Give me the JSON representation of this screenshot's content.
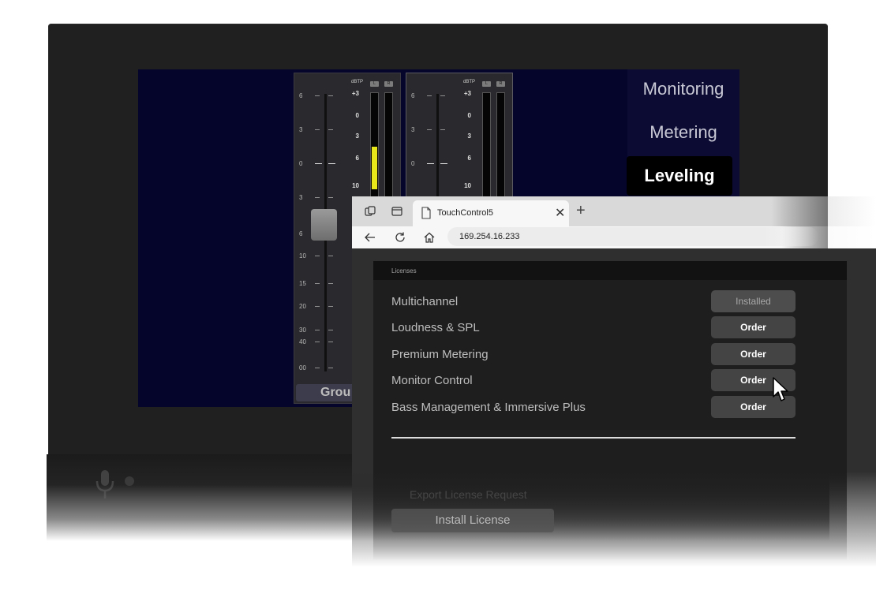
{
  "device": {
    "screen": {
      "strips": [
        {
          "fader_scale": [
            "6",
            "3",
            "0",
            "3",
            "6",
            "10",
            "15",
            "20",
            "30",
            "40",
            "00"
          ],
          "meter_header": "dBTP",
          "channels": [
            "L",
            "R"
          ],
          "meter_scale": [
            "+3",
            "0",
            "3",
            "6",
            "10"
          ],
          "meter_level_fraction": 0.15
        },
        {
          "fader_scale": [
            "6",
            "3",
            "0"
          ],
          "meter_header": "dBTP",
          "channels": [
            "L",
            "R"
          ],
          "meter_scale": [
            "+3",
            "0",
            "3",
            "6",
            "10"
          ]
        }
      ],
      "group_label": "Grou",
      "side_nav": [
        "Monitoring",
        "Metering",
        "Leveling"
      ],
      "side_nav_active": "Leveling",
      "meter_color": "#e7e71a"
    }
  },
  "browser": {
    "tab_title": "TouchControl5",
    "url": "169.254.16.233",
    "section_title": "Licenses",
    "licenses": [
      {
        "name": "Multichannel",
        "button": "Installed"
      },
      {
        "name": "Loudness & SPL",
        "button": "Order"
      },
      {
        "name": "Premium Metering",
        "button": "Order"
      },
      {
        "name": "Monitor Control",
        "button": "Order"
      },
      {
        "name": "Bass Management & Immersive Plus",
        "button": "Order"
      }
    ],
    "export_label": "Export License Request",
    "install_label": "Install License"
  }
}
